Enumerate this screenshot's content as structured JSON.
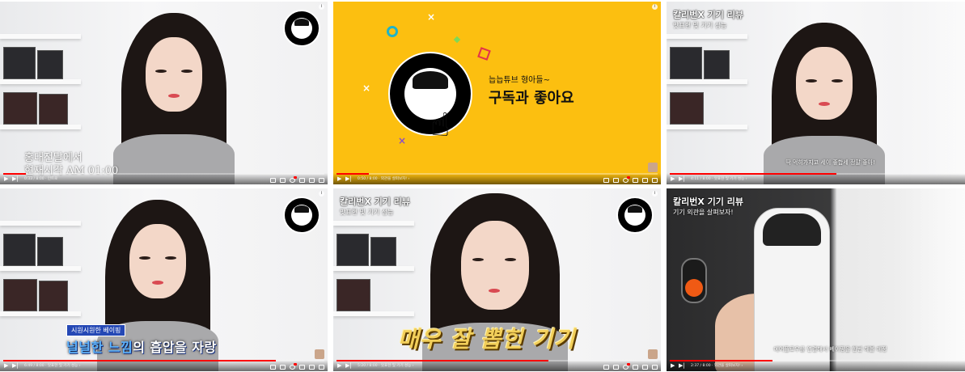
{
  "tiles": [
    {
      "id": "tile-1",
      "captions": [
        "홍대전달에서",
        "현재시각 AM 01:00"
      ],
      "time": "0:33 / 8:00 · 인트로",
      "progress": 0.07
    },
    {
      "id": "tile-2",
      "subtitle_small": "늡늡튜브 형아들~",
      "subtitle_big": "구독과 좋아요",
      "time": "0:50 / 8:00 · 외관을 살펴보자! ›",
      "progress": 0.1
    },
    {
      "id": "tile-3",
      "title": "칼리번X 기기 리뷰",
      "subtitle": "맛표현 및 기기 성능",
      "bottom_sub": "딱 먹히가지고 세이 좋합세 정말 좋아!",
      "time": "4:11 / 8:00 · 맛표현 및 기기 성능 ›",
      "progress": 0.52
    },
    {
      "id": "tile-4",
      "tag": "시원시원한 베이핑",
      "caption_hl1": "널널한",
      "caption_hl2": "느낌",
      "caption_rest": "의 흡압을 자랑",
      "time": "6:49 / 8:00 · 맛표현 및 기기 성능 ›",
      "progress": 0.85
    },
    {
      "id": "tile-5",
      "title": "칼리번X 기기 리뷰",
      "subtitle": "맛표현 및 기기 성능",
      "caption": "매우 잘 뽑힌 기기",
      "time": "5:20 / 8:00 · 맛표현 및 기기 성능 ›",
      "progress": 0.66
    },
    {
      "id": "tile-6",
      "title": "칼리번X 기기 리뷰",
      "subtitle": "기기 외관을 살펴보자!",
      "bottom_sub": "에어플로우를 연결해서 베이핑을 한번 해볼 예정",
      "time": "2:37 / 8:00 · 외관을 살펴보자! ›",
      "progress": 0.32
    }
  ],
  "controls": {
    "play_icon": "▶",
    "next_icon": "▶|",
    "volume_icon": "🔊"
  },
  "colors": {
    "progress": "#ff0000",
    "yellow_bg": "#fcbf10",
    "caption_blue": "#5fb4ff",
    "caption_gold": "#f2cf5a"
  }
}
